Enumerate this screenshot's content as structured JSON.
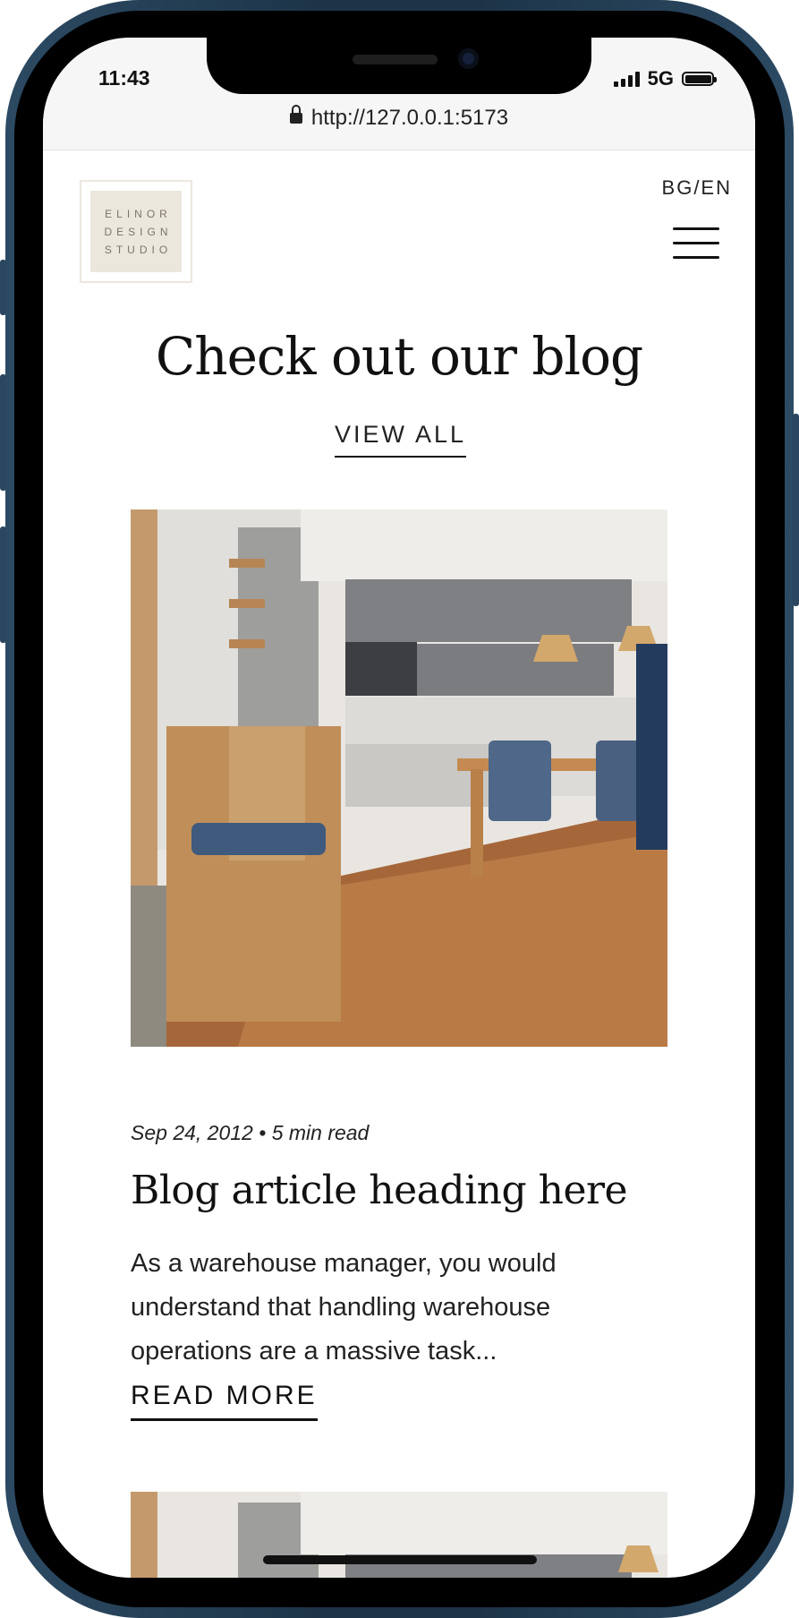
{
  "status_bar": {
    "time": "11:43",
    "network": "5G"
  },
  "browser": {
    "url": "http://127.0.0.1:5173"
  },
  "header": {
    "logo_lines": [
      "ELINOR",
      "DESIGN",
      "STUDIO"
    ],
    "language_toggle": "BG/EN"
  },
  "blog": {
    "heading": "Check out our blog",
    "view_all": "VIEW ALL",
    "post": {
      "date": "Sep 24, 2012",
      "separator": "•",
      "read_time": "5 min read",
      "title": "Blog article heading here",
      "excerpt": "As a warehouse manager, you would understand that handling warehouse operations are a massive task...",
      "read_more": "READ MORE"
    }
  },
  "colors": {
    "frame": "#1d3448",
    "logo_bg": "#ece7dd",
    "text": "#111111"
  }
}
